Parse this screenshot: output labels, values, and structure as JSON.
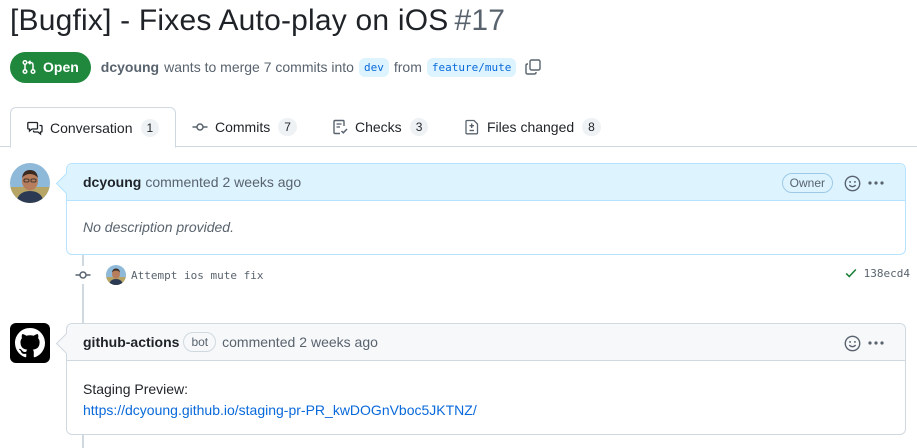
{
  "pull_request": {
    "title": "[Bugfix] - Fixes Auto-play on iOS",
    "number": "#17",
    "state": "Open",
    "author": "dcyoung",
    "merge_text": "wants to merge 7 commits into",
    "base_branch": "dev",
    "from_text": "from",
    "head_branch": "feature/mute"
  },
  "tabs": [
    {
      "label": "Conversation",
      "count": "1",
      "icon": "comment-discussion-icon"
    },
    {
      "label": "Commits",
      "count": "7",
      "icon": "git-commit-icon"
    },
    {
      "label": "Checks",
      "count": "3",
      "icon": "checklist-icon"
    },
    {
      "label": "Files changed",
      "count": "8",
      "icon": "file-diff-icon"
    }
  ],
  "comments": [
    {
      "author": "dcyoung",
      "action": "commented",
      "time": "2 weeks ago",
      "role_label": "Owner",
      "body": "No description provided."
    },
    {
      "author": "github-actions",
      "bot_label": "bot",
      "action": "commented",
      "time": "2 weeks ago",
      "body_line1": "Staging Preview:",
      "body_link": "https://dcyoung.github.io/staging-pr-PR_kwDOGnVboc5JKTNZ/"
    }
  ],
  "commit": {
    "message": "Attempt ios mute fix",
    "sha": "138ecd4",
    "status": "success"
  },
  "colors": {
    "open_green": "#1f883d",
    "link_blue": "#0969da",
    "header_blue": "#ddf4ff",
    "success_green": "#1a7f37"
  }
}
